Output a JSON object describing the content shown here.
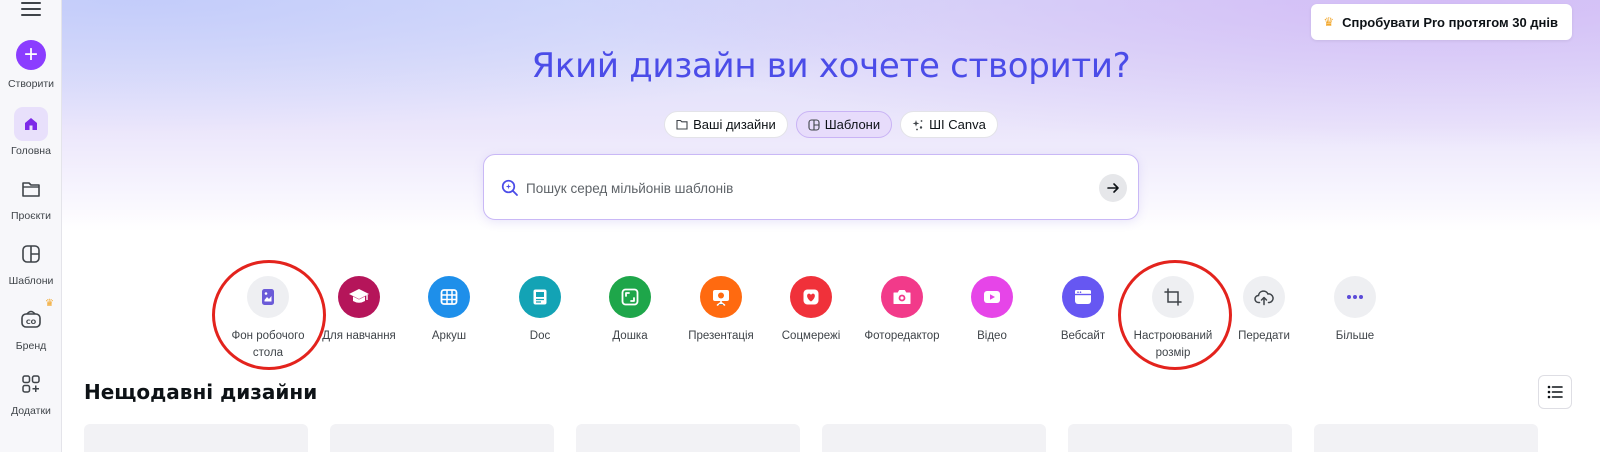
{
  "sidebar": {
    "items": [
      {
        "label": "Створити",
        "icon": "plus-icon"
      },
      {
        "label": "Головна",
        "icon": "home-icon"
      },
      {
        "label": "Проєкти",
        "icon": "folder-icon"
      },
      {
        "label": "Шаблони",
        "icon": "templates-icon"
      },
      {
        "label": "Бренд",
        "icon": "brand-icon"
      },
      {
        "label": "Додатки",
        "icon": "apps-icon"
      }
    ]
  },
  "header": {
    "pro_label": "Спробувати Pro протягом 30 днів",
    "title": "Який дизайн ви хочете створити?"
  },
  "tabs": [
    {
      "label": "Ваші дизайни",
      "icon": "folder-icon"
    },
    {
      "label": "Шаблони",
      "icon": "templates-icon",
      "active": true
    },
    {
      "label": "ШІ Canva",
      "icon": "sparkle-icon"
    }
  ],
  "search": {
    "placeholder": "Пошук серед мільйонів шаблонів",
    "value": ""
  },
  "categories": [
    {
      "label": "Фон робочого стола",
      "icon": "desktop-wallpaper-icon",
      "color": "#eeeff2"
    },
    {
      "label": "Для навчання",
      "icon": "graduation-cap-icon",
      "color": "#b5155a"
    },
    {
      "label": "Аркуш",
      "icon": "sheet-icon",
      "color": "#1e8fea"
    },
    {
      "label": "Doc",
      "icon": "doc-icon",
      "color": "#13a3b5"
    },
    {
      "label": "Дошка",
      "icon": "whiteboard-icon",
      "color": "#1ea64a"
    },
    {
      "label": "Презентація",
      "icon": "presentation-icon",
      "color": "#ff6a10"
    },
    {
      "label": "Соцмережі",
      "icon": "heart-icon",
      "color": "#f0313a"
    },
    {
      "label": "Фоторедактор",
      "icon": "camera-icon",
      "color": "#f23a8a"
    },
    {
      "label": "Відео",
      "icon": "video-icon",
      "color": "#e645e8"
    },
    {
      "label": "Вебсайт",
      "icon": "website-icon",
      "color": "#6657f2"
    },
    {
      "label": "Настроюваний розмір",
      "icon": "custom-size-icon",
      "color": "#eeeff2"
    },
    {
      "label": "Передати",
      "icon": "upload-cloud-icon",
      "color": "#eeeff2"
    },
    {
      "label": "Більше",
      "icon": "more-icon",
      "color": "#eeeff2"
    }
  ],
  "recent": {
    "title": "Нещодавні дизайни"
  },
  "colors": {
    "accent": "#8b3dff",
    "title": "#4b4ce8",
    "annotation": "#e3231d"
  }
}
